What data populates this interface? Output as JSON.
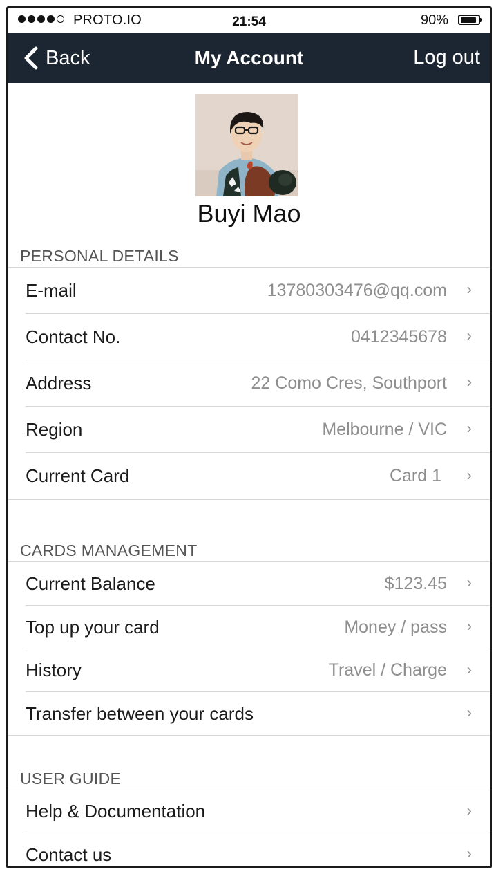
{
  "status_bar": {
    "carrier": "PROTO.IO",
    "time": "21:54",
    "battery": "90%",
    "signal_bars_on": 4,
    "signal_bars_total": 5,
    "battery_level": 0.9
  },
  "nav": {
    "back_label": "Back",
    "title": "My Account",
    "logout_label": "Log out",
    "background_color": "#1c2632"
  },
  "profile": {
    "name": "Buyi Mao"
  },
  "personal": {
    "header": "PERSONAL DETAILS",
    "rows": [
      {
        "label": "E-mail",
        "value": "13780303476@qq.com"
      },
      {
        "label": "Contact No.",
        "value": "0412345678"
      },
      {
        "label": "Address",
        "value": "22 Como Cres, Southport"
      },
      {
        "label": "Region",
        "value": "Melbourne / VIC"
      },
      {
        "label": "Current Card",
        "value": "Card 1"
      }
    ]
  },
  "cards": {
    "header": "CARDS MANAGEMENT",
    "rows": [
      {
        "label": "Current Balance",
        "value": "$123.45"
      },
      {
        "label": "Top up your card",
        "value": "Money / pass"
      },
      {
        "label": "History",
        "value": "Travel / Charge"
      },
      {
        "label": "Transfer between your cards",
        "value": ""
      }
    ]
  },
  "guide": {
    "header": "USER GUIDE",
    "rows": [
      {
        "label": "Help & Documentation",
        "value": ""
      },
      {
        "label": "Contact us",
        "value": ""
      }
    ]
  },
  "icons": {
    "chevron": "›",
    "back": "chevron-left-icon",
    "battery": "battery-icon",
    "signal": "signal-dots-icon"
  }
}
